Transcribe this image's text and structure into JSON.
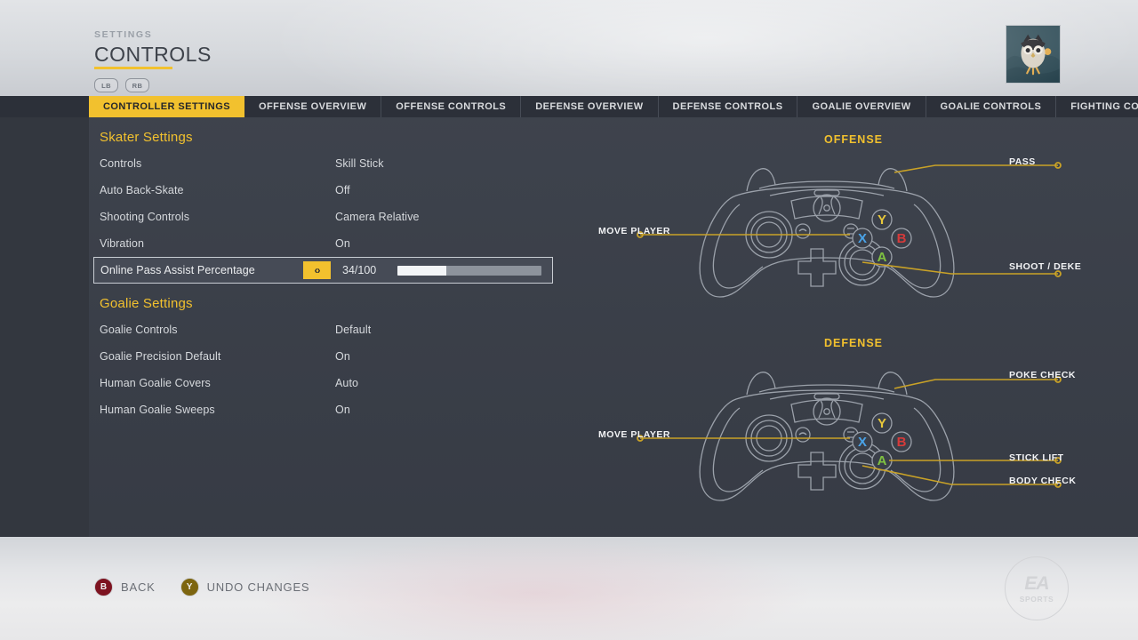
{
  "header": {
    "eyebrow": "SETTINGS",
    "title": "CONTROLS",
    "bumper_left": "LB",
    "bumper_right": "RB",
    "avatar_name": "owl-avatar"
  },
  "tabs": [
    {
      "label": "CONTROLLER SETTINGS",
      "active": true
    },
    {
      "label": "OFFENSE OVERVIEW",
      "active": false
    },
    {
      "label": "OFFENSE CONTROLS",
      "active": false
    },
    {
      "label": "DEFENSE OVERVIEW",
      "active": false
    },
    {
      "label": "DEFENSE CONTROLS",
      "active": false
    },
    {
      "label": "GOALIE OVERVIEW",
      "active": false
    },
    {
      "label": "GOALIE CONTROLS",
      "active": false
    },
    {
      "label": "FIGHTING CO",
      "active": false
    }
  ],
  "settings": {
    "sections": [
      {
        "title": "Skater Settings",
        "rows": [
          {
            "label": "Controls",
            "value": "Skill Stick",
            "type": "option"
          },
          {
            "label": "Auto Back-Skate",
            "value": "Off",
            "type": "option"
          },
          {
            "label": "Shooting Controls",
            "value": "Camera Relative",
            "type": "option"
          },
          {
            "label": "Vibration",
            "value": "On",
            "type": "option"
          },
          {
            "label": "Online Pass Assist Percentage",
            "value": "34/100",
            "type": "slider",
            "selected": true,
            "slider_percent": 34,
            "slider_min": 0,
            "slider_max": 100,
            "arrows": "‹›"
          }
        ]
      },
      {
        "title": "Goalie Settings",
        "rows": [
          {
            "label": "Goalie Controls",
            "value": "Default",
            "type": "option"
          },
          {
            "label": "Goalie Precision Default",
            "value": "On",
            "type": "option"
          },
          {
            "label": "Human Goalie Covers",
            "value": "Auto",
            "type": "option"
          },
          {
            "label": "Human Goalie Sweeps",
            "value": "On",
            "type": "option"
          }
        ]
      }
    ]
  },
  "diagrams": [
    {
      "title": "OFFENSE",
      "callouts": [
        {
          "text": "PASS",
          "side": "right"
        },
        {
          "text": "MOVE PLAYER",
          "side": "left"
        },
        {
          "text": "SHOOT / DEKE",
          "side": "right"
        }
      ]
    },
    {
      "title": "DEFENSE",
      "callouts": [
        {
          "text": "POKE CHECK",
          "side": "right"
        },
        {
          "text": "MOVE PLAYER",
          "side": "left"
        },
        {
          "text": "STICK LIFT",
          "side": "right"
        },
        {
          "text": "BODY CHECK",
          "side": "right"
        }
      ]
    }
  ],
  "controller_buttons": {
    "y": "Y",
    "x": "X",
    "b": "B",
    "a": "A"
  },
  "footer": {
    "prompts": [
      {
        "button": "B",
        "label": "BACK"
      },
      {
        "button": "Y",
        "label": "UNDO CHANGES"
      }
    ],
    "logo_primary": "EA",
    "logo_secondary": "SPORTS"
  },
  "colors": {
    "accent_yellow": "#f2c12e",
    "panel_bg": "#3a3f49",
    "tabbar_bg": "#2c3039",
    "button_y": "#e8c83a",
    "button_x": "#4aa3e8",
    "button_b": "#d63a3a",
    "button_a": "#7fc241",
    "text_light": "#d6d9dd"
  }
}
